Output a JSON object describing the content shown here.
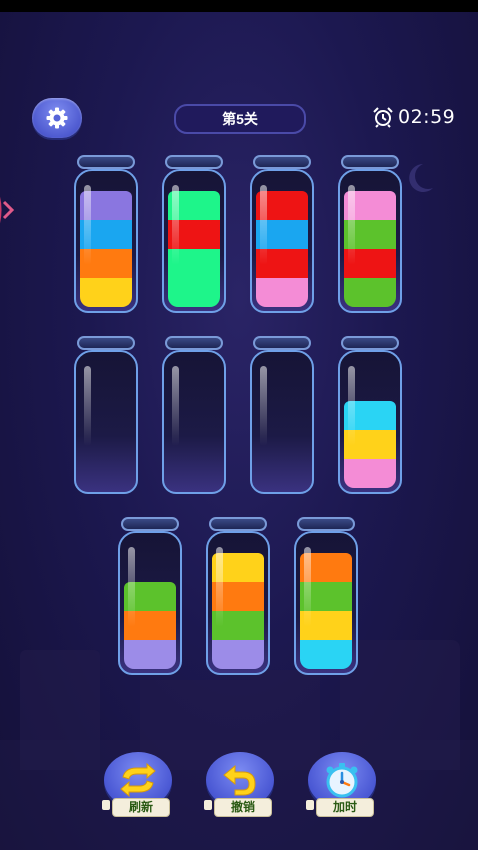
{
  "header": {
    "level_label": "第5关",
    "timer": "02:59",
    "settings_icon": "gear-icon",
    "timer_icon": "alarm-clock-icon"
  },
  "colors": {
    "purple": "#8a76e0",
    "blue": "#1aa6f0",
    "orange": "#ff7a10",
    "yellow": "#ffd21a",
    "green": "#1ef58a",
    "red": "#ee1414",
    "pink": "#f48cd6",
    "olive": "#5cc22c",
    "lavender": "#9c8ce8",
    "cyan": "#2ad4f4"
  },
  "bottles": [
    {
      "id": "1",
      "layers": [
        "yellow",
        "orange",
        "blue",
        "purple"
      ]
    },
    {
      "id": "2",
      "layers": [
        "green",
        "green",
        "red",
        "green"
      ]
    },
    {
      "id": "3",
      "layers": [
        "pink",
        "red",
        "blue",
        "red"
      ]
    },
    {
      "id": "4",
      "layers": [
        "olive",
        "red",
        "olive",
        "pink"
      ]
    },
    {
      "id": "5",
      "layers": []
    },
    {
      "id": "6",
      "layers": []
    },
    {
      "id": "7",
      "layers": []
    },
    {
      "id": "8",
      "layers": [
        "pink",
        "yellow",
        "cyan"
      ]
    },
    {
      "id": "9",
      "layers": [
        "lavender",
        "orange",
        "olive"
      ]
    },
    {
      "id": "10",
      "layers": [
        "lavender",
        "olive",
        "orange",
        "yellow"
      ]
    },
    {
      "id": "11",
      "layers": [
        "cyan",
        "yellow",
        "olive",
        "orange"
      ]
    }
  ],
  "toolbar": {
    "refresh_label": "刷新",
    "undo_label": "撤销",
    "add_time_label": "加时",
    "refresh_icon": "refresh-arrows-icon",
    "undo_icon": "undo-arrow-icon",
    "add_time_icon": "stopwatch-icon"
  }
}
